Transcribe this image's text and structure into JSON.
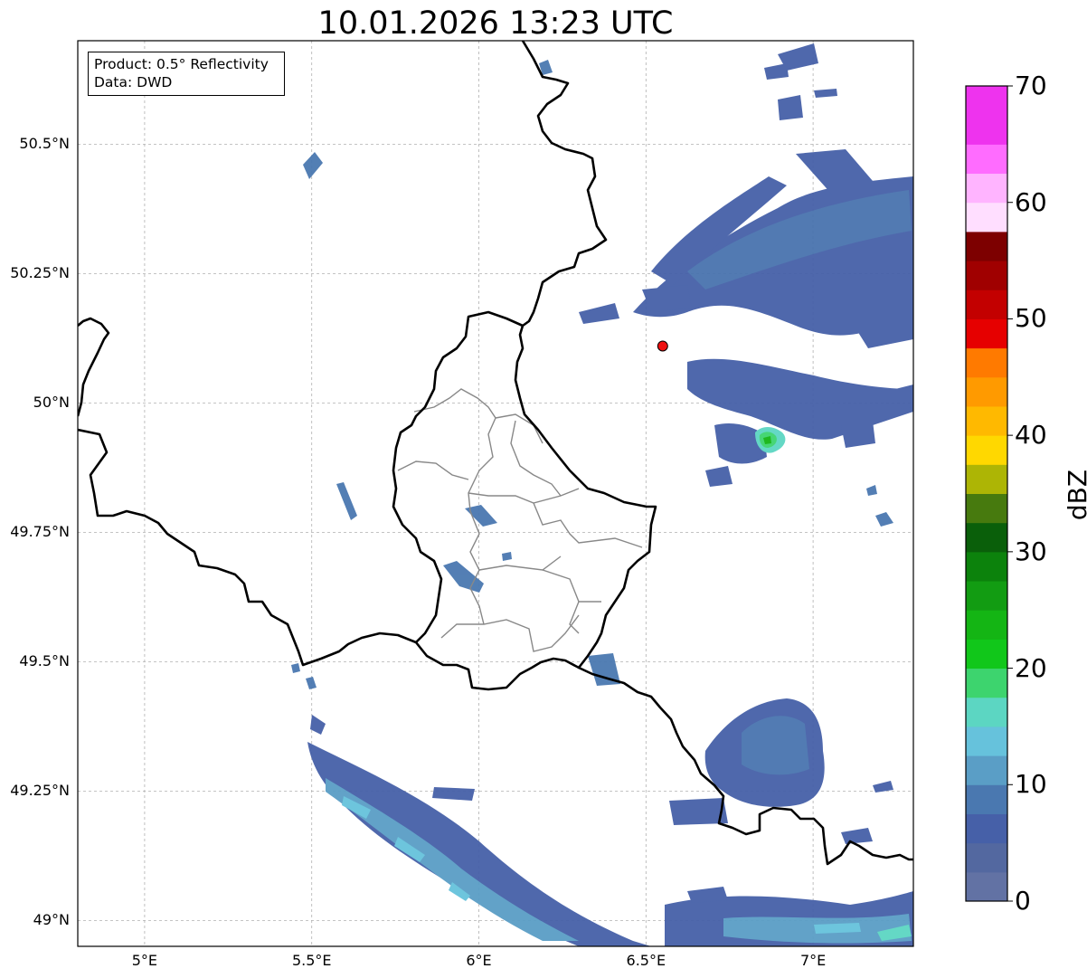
{
  "title": "10.01.2026 13:23 UTC",
  "info_box": {
    "product": "Product: 0.5° Reflectivity",
    "data_source": "Data: DWD"
  },
  "map": {
    "lon_range": [
      4.8,
      7.3
    ],
    "lat_range": [
      48.95,
      50.7
    ],
    "lat_ticks": [
      {
        "value": 50.5,
        "label": "50.5°N"
      },
      {
        "value": 50.25,
        "label": "50.25°N"
      },
      {
        "value": 50.0,
        "label": "50°N"
      },
      {
        "value": 49.75,
        "label": "49.75°N"
      },
      {
        "value": 49.5,
        "label": "49.5°N"
      },
      {
        "value": 49.25,
        "label": "49.25°N"
      },
      {
        "value": 49.0,
        "label": "49°N"
      }
    ],
    "lon_ticks": [
      {
        "value": 5.0,
        "label": "5°E"
      },
      {
        "value": 5.5,
        "label": "5.5°E"
      },
      {
        "value": 6.0,
        "label": "6°E"
      },
      {
        "value": 6.5,
        "label": "6.5°E"
      },
      {
        "value": 7.0,
        "label": "7°E"
      }
    ],
    "grid": true,
    "radar_site": {
      "lon": 6.55,
      "lat": 50.11,
      "color": "#ee1111"
    },
    "echo_areas": [
      {
        "name": "northeast band",
        "lon": 6.85,
        "lat": 50.27,
        "dbz": 8
      },
      {
        "name": "east band",
        "lon": 6.9,
        "lat": 49.99,
        "dbz": 8
      },
      {
        "name": "convective cell",
        "lon": 6.86,
        "lat": 49.94,
        "dbz": 20
      },
      {
        "name": "southeast area",
        "lon": 6.85,
        "lat": 49.28,
        "dbz": 9
      },
      {
        "name": "southwest band",
        "lon": 5.8,
        "lat": 49.15,
        "dbz": 12
      },
      {
        "name": "south band",
        "lon": 6.95,
        "lat": 49.02,
        "dbz": 11
      }
    ]
  },
  "colorbar": {
    "label": "dBZ",
    "vmin": 0,
    "vmax": 70,
    "tick_values": [
      0,
      10,
      20,
      30,
      40,
      50,
      60,
      70
    ],
    "tick_labels": [
      "0",
      "10",
      "20",
      "30",
      "40",
      "50",
      "60",
      "70"
    ],
    "colors": [
      "#6272a4",
      "#5368a0",
      "#4660a8",
      "#4a78b0",
      "#5a9ec6",
      "#66c2dc",
      "#5cd6c2",
      "#3dd46e",
      "#11c71a",
      "#14b514",
      "#129c12",
      "#0c820c",
      "#0a5f0a",
      "#477a0e",
      "#adb505",
      "#ffd800",
      "#ffb900",
      "#ff9a00",
      "#ff7a00",
      "#e60000",
      "#c30000",
      "#a00000",
      "#7d0000",
      "#ffdeff",
      "#ffb4ff",
      "#ff6cff",
      "#ee33ee"
    ],
    "lower_boundaries": [
      0,
      2.5,
      5,
      7.5,
      10,
      12.5,
      15,
      17.5,
      20,
      22.5,
      25,
      27.5,
      30,
      32.5,
      35,
      37.5,
      40,
      42.5,
      45,
      47.5,
      50,
      52.5,
      55,
      57.5,
      60,
      62.5,
      65
    ]
  }
}
